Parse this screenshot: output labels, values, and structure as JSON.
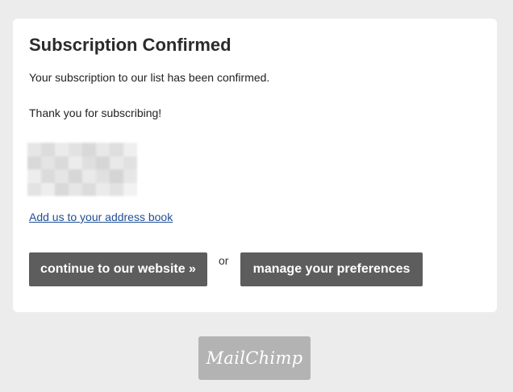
{
  "card": {
    "title": "Subscription Confirmed",
    "message": "Your subscription to our list has been confirmed.",
    "thanks": "Thank you for subscribing!",
    "address_link": "Add us to your address book",
    "continue_button": "continue to our website »",
    "or_text": "or",
    "preferences_button": "manage your preferences"
  },
  "footer": {
    "badge_text": "MailChimp"
  },
  "colors": {
    "page_background": "#ececec",
    "card_background": "#ffffff",
    "button_background": "#5d5d5d",
    "link": "#1f4e96",
    "badge_background": "#b3b3b3"
  },
  "icons": {
    "blurred_image": "pixelated-placeholder-image"
  }
}
